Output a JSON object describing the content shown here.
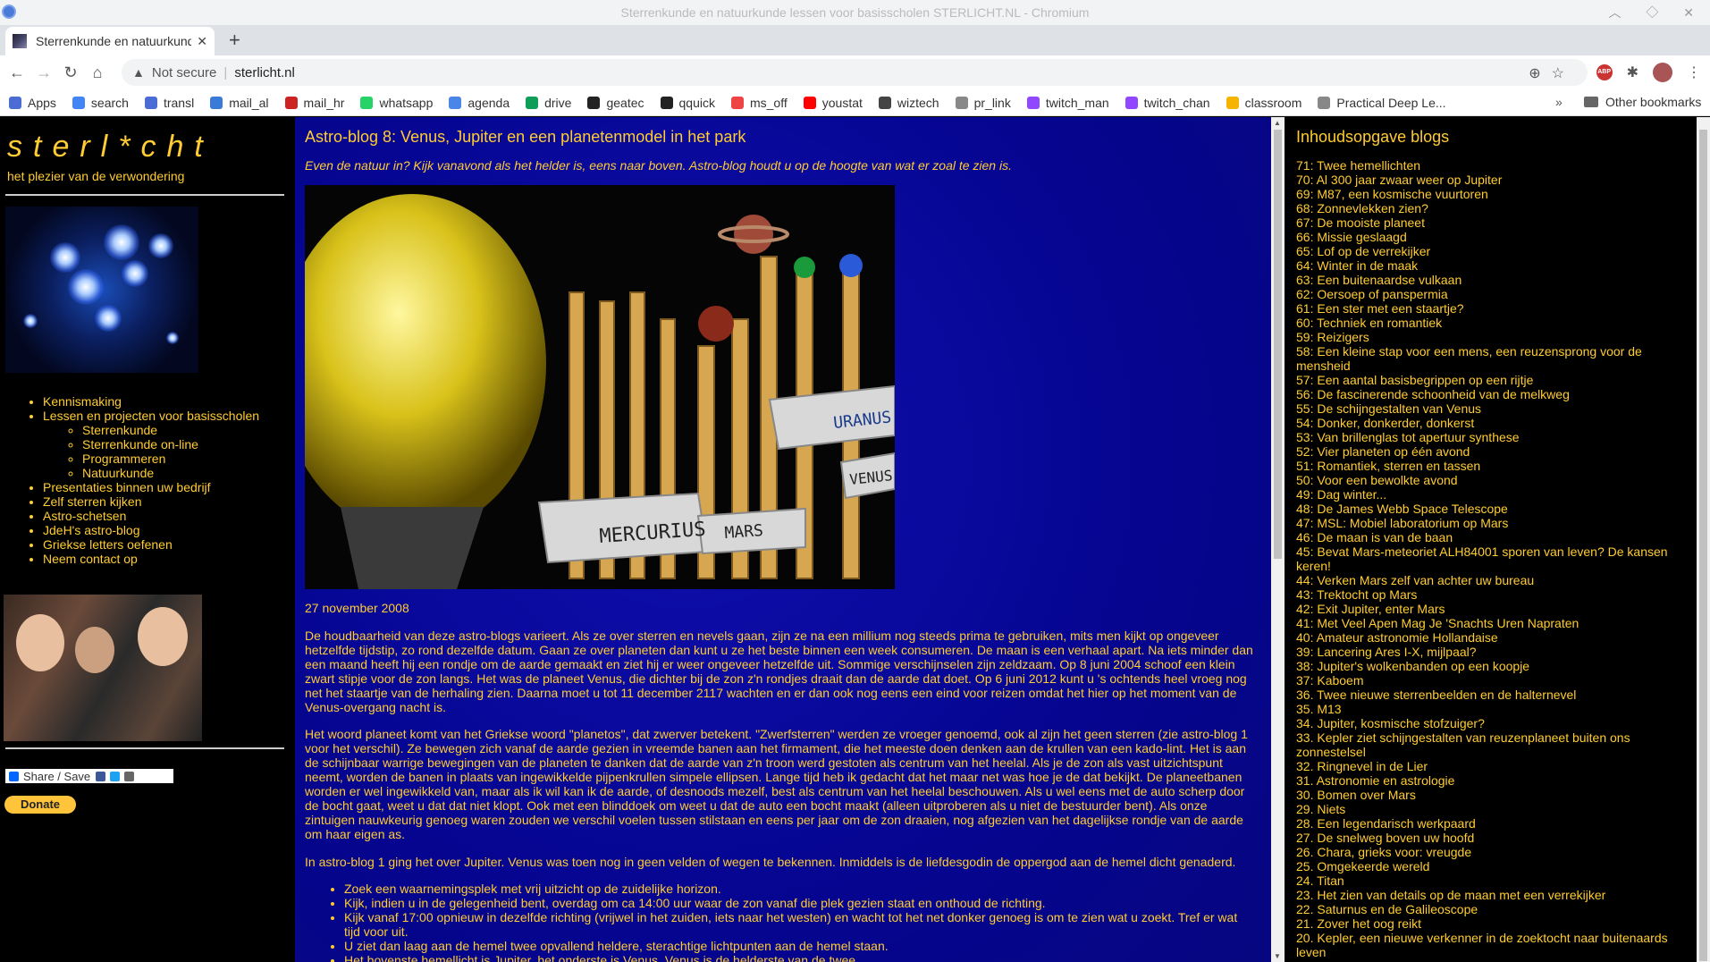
{
  "browser": {
    "window_title": "Sterrenkunde en natuurkunde lessen voor basisscholen STERLICHT.NL - Chromium",
    "tab_title": "Sterrenkunde en natuurkunde",
    "security_label": "Not secure",
    "url": "sterlicht.nl",
    "abp_label": "ABP",
    "bookmarks": [
      "Apps",
      "search",
      "transl",
      "mail_al",
      "mail_hr",
      "whatsapp",
      "agenda",
      "drive",
      "geatec",
      "qquick",
      "ms_off",
      "youstat",
      "wiztech",
      "pr_link",
      "twitch_man",
      "twitch_chan",
      "classroom",
      "Practical Deep Le..."
    ],
    "other_bookmarks": "Other bookmarks"
  },
  "site": {
    "logo": "sterl*cht",
    "tagline": "het plezier van de verwondering",
    "nav": {
      "kennismaking": "Kennismaking",
      "lessen": "Lessen en projecten voor basisscholen",
      "sub": [
        "Sterrenkunde",
        "Sterrenkunde on-line",
        "Programmeren",
        "Natuurkunde"
      ],
      "presentaties": "Presentaties binnen uw bedrijf",
      "zelf": "Zelf sterren kijken",
      "schetsen": "Astro-schetsen",
      "blog": "JdeH's astro-blog",
      "griekse": "Griekse letters oefenen",
      "contact": "Neem contact op"
    },
    "share_label": "Share / Save",
    "donate_label": "Donate"
  },
  "article": {
    "title": "Astro-blog 8: Venus, Jupiter en een planetenmodel in het park",
    "intro": "Even de natuur in? Kijk vanavond als het helder is, eens naar boven. Astro-blog houdt u op de hoogte van wat er zoal te zien is.",
    "photo_labels": [
      "MERCURIUS",
      "MARS",
      "VENUS",
      "URANUS"
    ],
    "date": "27 november 2008",
    "p1": "De houdbaarheid van deze astro-blogs varieert. Als ze over sterren en nevels gaan, zijn ze na een millium nog steeds prima te gebruiken, mits men kijkt op ongeveer hetzelfde tijdstip, zo rond dezelfde datum. Gaan ze over planeten dan kunt u ze het beste binnen een week consumeren. De maan is een verhaal apart. Na iets minder dan een maand heeft hij een rondje om de aarde gemaakt en ziet hij er weer ongeveer hetzelfde uit. Sommige verschijnselen zijn zeldzaam. Op 8 juni 2004 schoof een klein zwart stipje voor de zon langs. Het was de planeet Venus, die dichter bij de zon z'n rondjes draait dan de aarde dat doet. Op 6 juni 2012 kunt u 's ochtends heel vroeg nog net het staartje van de herhaling zien. Daarna moet u tot 11 december 2117 wachten en er dan ook nog eens een eind voor reizen omdat het hier op het moment van de Venus-overgang nacht is.",
    "p2": "Het woord planeet komt van het Griekse woord \"planetos\", dat zwerver betekent. \"Zwerfsterren\" werden ze vroeger genoemd, ook al zijn het geen sterren (zie astro-blog 1 voor het verschil). Ze bewegen zich vanaf de aarde gezien in vreemde banen aan het firmament, die het meeste doen denken aan de krullen van een kado-lint. Het is aan de schijnbaar warrige bewegingen van de planeten te danken dat de aarde van z'n troon werd gestoten als centrum van het heelal. Als je de zon als vast uitzichtspunt neemt, worden de banen in plaats van ingewikkelde pijpenkrullen simpele ellipsen. Lange tijd heb ik gedacht dat het maar net was hoe je de dat bekijkt. De planeetbanen worden er wel ingewikkeld van, maar als ik wil kan ik de aarde, of desnoods mezelf, best als centrum van het heelal beschouwen. Als u wel eens met de auto scherp door de bocht gaat, weet u dat dat niet klopt. Ook met een blinddoek om weet u dat de auto een bocht maakt (alleen uitproberen als u niet de bestuurder bent). Als onze zintuigen nauwkeurig genoeg waren zouden we verschil voelen tussen stilstaan en eens per jaar om de zon draaien, nog afgezien van het dagelijkse rondje van de aarde om haar eigen as.",
    "p3": "In astro-blog 1 ging het over Jupiter. Venus was toen nog in geen velden of wegen te bekennen. Inmiddels is de liefdesgodin de oppergod aan de hemel dicht genaderd.",
    "bullets": [
      "Zoek een waarnemingsplek met vrij uitzicht op de zuidelijke horizon.",
      "Kijk, indien u in de gelegenheid bent, overdag om ca 14:00 uur waar de zon vanaf die plek gezien staat en onthoud de richting.",
      "Kijk vanaf 17:00 opnieuw in dezelfde richting (vrijwel in het zuiden, iets naar het westen) en wacht tot het net donker genoeg is om te zien wat u zoekt. Tref er wat tijd voor uit.",
      "U ziet dan laag aan de hemel twee opvallend heldere, sterachtige lichtpunten aan de hemel staan.",
      "Het bovenste hemellicht is Jupiter, het onderste is Venus. Venus is de helderste van de twee."
    ]
  },
  "toc": {
    "title": "Inhoudsopgave blogs",
    "items": [
      "71: Twee hemellichten",
      "70: Al 300 jaar zwaar weer op Jupiter",
      "69: M87, een kosmische vuurtoren",
      "68: Zonnevlekken zien?",
      "67: De mooiste planeet",
      "66: Missie geslaagd",
      "65: Lof op de verrekijker",
      "64: Winter in de maak",
      "63: Een buitenaardse vulkaan",
      "62: Oersoep of panspermia",
      "61: Een ster met een staartje?",
      "60: Techniek en romantiek",
      "59: Reizigers",
      "58: Een kleine stap voor een mens, een reuzensprong voor de mensheid",
      "57: Een aantal basisbegrippen op een rijtje",
      "56: De fascinerende schoonheid van de melkweg",
      "55: De schijngestalten van Venus",
      "54: Donker, donkerder, donkerst",
      "53: Van brillenglas tot apertuur synthese",
      "52: Vier planeten op één avond",
      "51: Romantiek, sterren en tassen",
      "50: Voor een bewolkte avond",
      "49: Dag winter...",
      "48: De James Webb Space Telescope",
      "47: MSL: Mobiel laboratorium op Mars",
      "46: De maan is van de baan",
      "45: Bevat Mars-meteoriet ALH84001 sporen van leven? De kansen keren!",
      "44: Verken Mars zelf van achter uw bureau",
      "43: Trektocht op Mars",
      "42: Exit Jupiter, enter Mars",
      "41: Met Veel Apen Mag Je 'Snachts Uren Napraten",
      "40: Amateur astronomie Hollandaise",
      "39: Lancering Ares I-X, mijlpaal?",
      "38: Jupiter's wolkenbanden op een koopje",
      "37: Kaboem",
      "36. Twee nieuwe sterrenbeelden en de halternevel",
      "35. M13",
      "34. Jupiter, kosmische stofzuiger?",
      "33. Kepler ziet schijngestalten van reuzenplaneet buiten ons zonnestelsel",
      "32. Ringnevel in de Lier",
      "31. Astronomie en astrologie",
      "30. Bomen over Mars",
      "29. Niets",
      "28. Een legendarisch werkpaard",
      "27. De snelweg boven uw hoofd",
      "26. Chara, grieks voor: vreugde",
      "25. Omgekeerde wereld",
      "24. Titan",
      "23. Het zien van details op de maan met een verrekijker",
      "22. Saturnus en de Galileoscope",
      "21. Zover het oog reikt",
      "20. Kepler, een nieuwe verkenner in de zoektocht naar buitenaards leven"
    ]
  }
}
